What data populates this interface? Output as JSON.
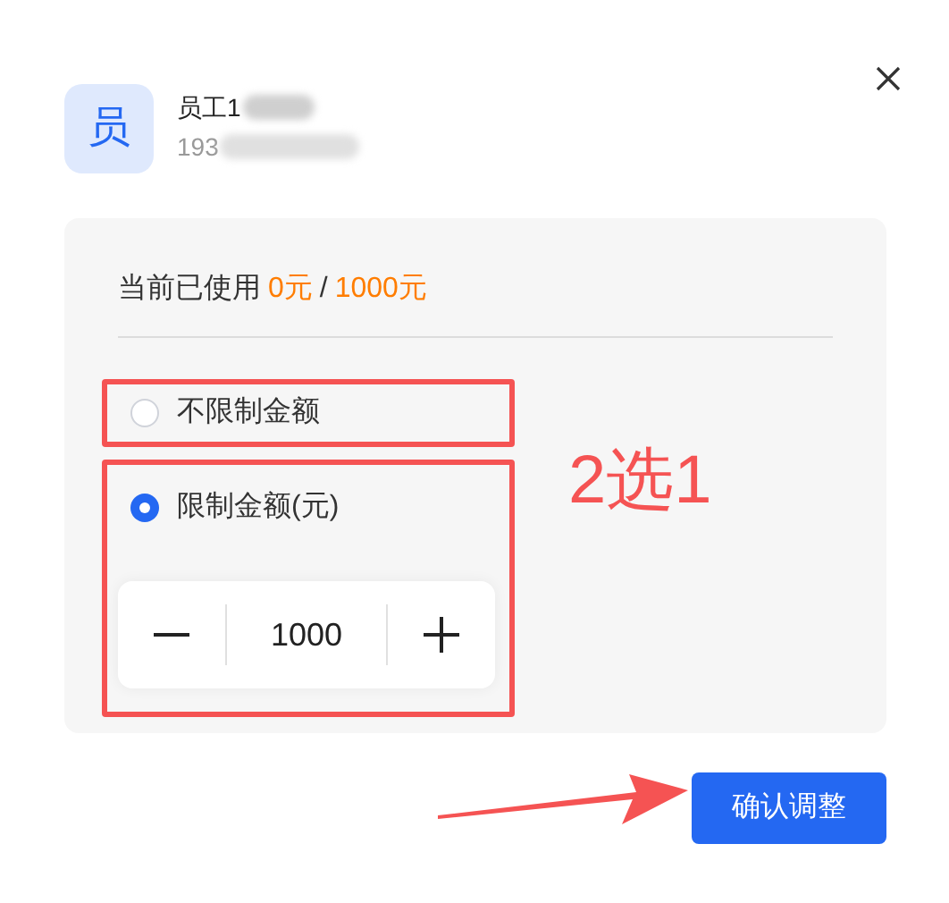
{
  "user": {
    "avatar": "员",
    "name": "员工1",
    "phone": "193"
  },
  "usage": {
    "label": "当前已使用",
    "used": "0元",
    "separator": "/",
    "limit": "1000元"
  },
  "options": [
    {
      "label": "不限制金额",
      "selected": false
    },
    {
      "label": "限制金额(元)",
      "selected": true
    }
  ],
  "stepper": {
    "value": "1000"
  },
  "annotation": "2选1",
  "confirm_button": "确认调整"
}
